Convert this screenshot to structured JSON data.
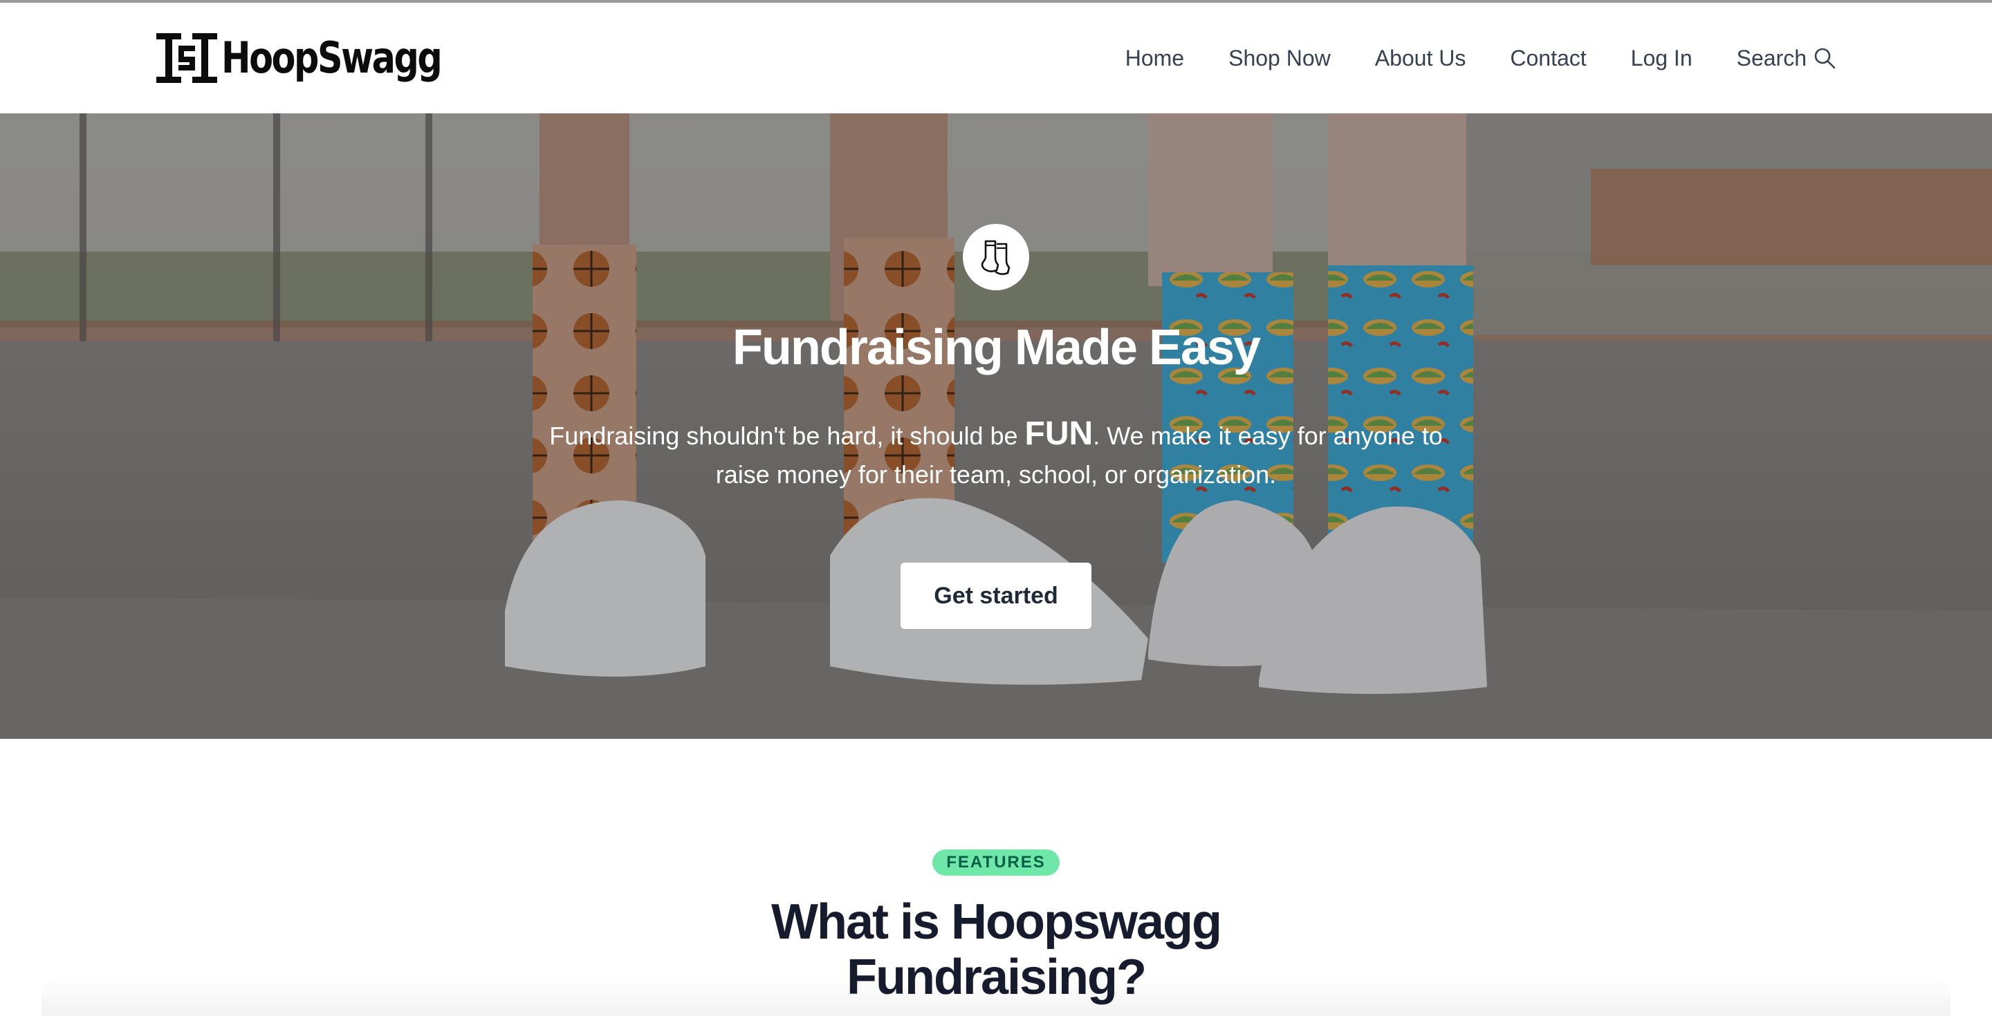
{
  "header": {
    "logo_text": "HoopSwagg",
    "nav": [
      {
        "label": "Home"
      },
      {
        "label": "Shop Now"
      },
      {
        "label": "About Us"
      },
      {
        "label": "Contact"
      },
      {
        "label": "Log In"
      },
      {
        "label": "Search",
        "icon": "search-icon"
      }
    ]
  },
  "hero": {
    "icon": "socks-icon",
    "title": "Fundraising Made Easy",
    "subtitle_before": "Fundraising shouldn't be hard, it should be ",
    "subtitle_emphasis": "FUN",
    "subtitle_after": ". We make it easy for anyone to raise money for their team, school, or organization.",
    "cta_label": "Get started"
  },
  "features": {
    "badge": "FEATURES",
    "title": "What is Hoopswagg Fundraising?"
  },
  "colors": {
    "badge_bg": "#6ee7a8",
    "badge_text": "#065f46",
    "nav_text": "#374151",
    "heading": "#161b2e"
  }
}
